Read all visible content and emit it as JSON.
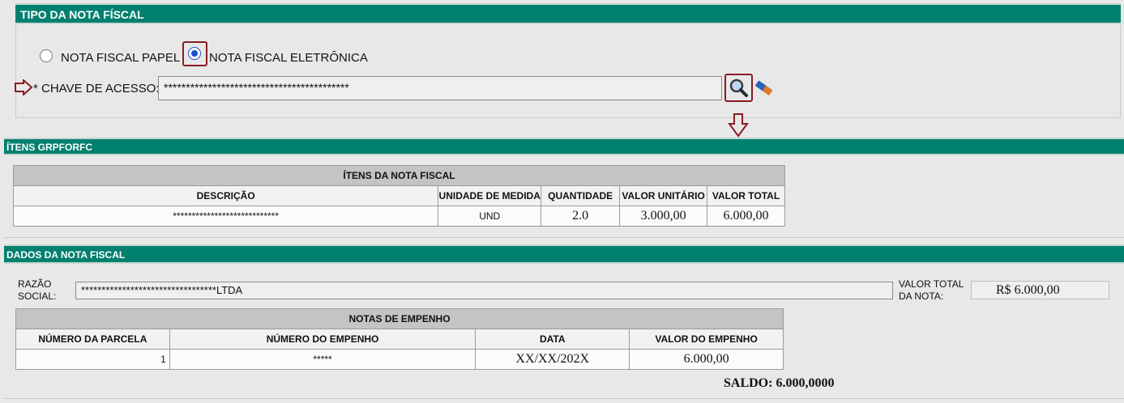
{
  "tipo": {
    "title": "TIPO DA NOTA FÍSCAL",
    "options": [
      {
        "label": "NOTA FISCAL PAPEL",
        "selected": false
      },
      {
        "label": "NOTA FISCAL ELETRÔNICA",
        "selected": true
      }
    ],
    "chave_label": "* CHAVE DE ACESSO:",
    "chave_value": "******************************************"
  },
  "itens": {
    "title": "ÍTENS GRPFORFC",
    "table_title": "ÍTENS DA NOTA FISCAL",
    "columns": [
      "DESCRIÇÃO",
      "UNIDADE DE MEDIDA",
      "QUANTIDADE",
      "VALOR UNITÁRIO",
      "VALOR TOTAL"
    ],
    "rows": [
      [
        "****************************",
        "UND",
        "2.0",
        "3.000,00",
        "6.000,00"
      ]
    ]
  },
  "dados": {
    "title": "DADOS DA NOTA FISCAL",
    "razao_label_1": "RAZÃO",
    "razao_label_2": "SOCIAL:",
    "razao_value": "*********************************LTDA",
    "valor_label_1": "VALOR TOTAL",
    "valor_label_2": "DA NOTA:",
    "valor_value": "R$ 6.000,00",
    "empenho_title": "NOTAS DE EMPENHO",
    "empenho_columns": [
      "NÚMERO DA PARCELA",
      "NÚMERO DO EMPENHO",
      "DATA",
      "VALOR DO EMPENHO"
    ],
    "empenho_rows": [
      [
        "1",
        "*****",
        "XX/XX/202X",
        "6.000,00"
      ]
    ],
    "saldo": "SALDO: 6.000,0000"
  },
  "colors": {
    "section_bar": "#00806f",
    "annotation_red": "#8a1c24",
    "radio_selected": "#1f4fd0"
  }
}
